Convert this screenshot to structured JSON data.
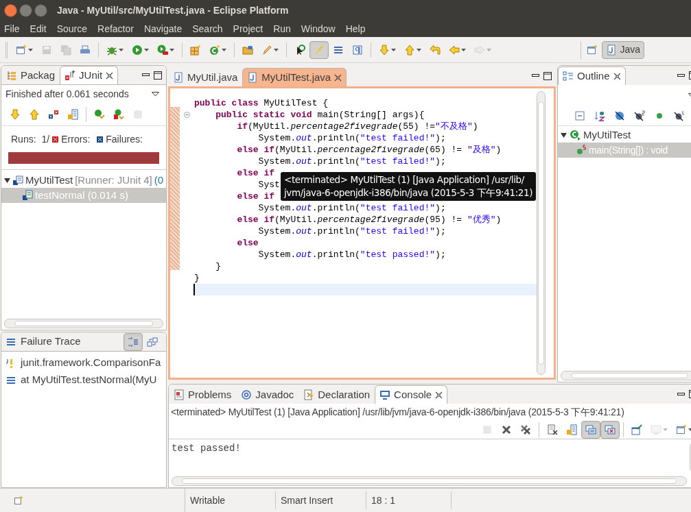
{
  "window": {
    "title": "Java - MyUtil/src/MyUtilTest.java - Eclipse Platform"
  },
  "menu": [
    "File",
    "Edit",
    "Source",
    "Refactor",
    "Navigate",
    "Search",
    "Project",
    "Run",
    "Window",
    "Help"
  ],
  "toolbar": [
    [
      {
        "kind": "new",
        "menu": true,
        "disabled": false,
        "pressed": false
      },
      {
        "kind": "save",
        "menu": false,
        "disabled": true,
        "pressed": false
      },
      {
        "kind": "save-all",
        "menu": false,
        "disabled": true,
        "pressed": false
      },
      {
        "kind": "print",
        "menu": false,
        "disabled": false,
        "pressed": false
      }
    ],
    [
      {
        "kind": "bug",
        "menu": true,
        "disabled": false,
        "pressed": false
      },
      {
        "kind": "run",
        "menu": true,
        "disabled": false,
        "pressed": false
      },
      {
        "kind": "run-tool",
        "menu": true,
        "disabled": false,
        "pressed": false
      }
    ],
    [
      {
        "kind": "package",
        "menu": false,
        "disabled": false,
        "pressed": false
      },
      {
        "kind": "class",
        "menu": true,
        "disabled": false,
        "pressed": false
      }
    ],
    [
      {
        "kind": "folder",
        "menu": false,
        "disabled": false,
        "pressed": false
      },
      {
        "kind": "pen",
        "menu": true,
        "disabled": false,
        "pressed": false
      }
    ],
    [
      {
        "kind": "pointer",
        "menu": false,
        "disabled": false,
        "pressed": false
      },
      {
        "kind": "brush",
        "menu": false,
        "disabled": false,
        "pressed": true
      },
      {
        "kind": "frame",
        "menu": false,
        "disabled": false,
        "pressed": false
      },
      {
        "kind": "pilcrow",
        "menu": false,
        "disabled": false,
        "pressed": false
      }
    ],
    [
      {
        "kind": "down",
        "menu": true,
        "disabled": false,
        "pressed": false
      },
      {
        "kind": "up",
        "menu": true,
        "disabled": false,
        "pressed": false
      },
      {
        "kind": "return",
        "menu": false,
        "disabled": false,
        "pressed": false
      },
      {
        "kind": "left",
        "menu": true,
        "disabled": false,
        "pressed": false
      },
      {
        "kind": "right",
        "menu": true,
        "disabled": true,
        "pressed": false
      }
    ]
  ],
  "perspective": {
    "label": "Java",
    "selected": true
  },
  "junit_view": {
    "tabs": [
      {
        "label": "Packag",
        "kind": "packages",
        "selected": false
      },
      {
        "label": "JUnit",
        "kind": "junit",
        "selected": true
      }
    ],
    "status": "Finished after 0.061 seconds",
    "toolbar": [
      [
        {
          "kind": "down",
          "menu": false,
          "disabled": false,
          "pressed": false
        },
        {
          "kind": "up",
          "menu": false,
          "disabled": false,
          "pressed": false
        },
        {
          "kind": "crosses",
          "menu": false,
          "disabled": false,
          "pressed": false
        },
        {
          "kind": "layout",
          "menu": false,
          "disabled": false,
          "pressed": false
        }
      ],
      [
        {
          "kind": "rerun",
          "menu": false,
          "disabled": false,
          "pressed": false
        },
        {
          "kind": "rerun-failed",
          "menu": false,
          "disabled": false,
          "pressed": false
        },
        {
          "kind": "stop",
          "menu": false,
          "disabled": true,
          "pressed": false
        }
      ]
    ],
    "counters": [
      {
        "kind": "runs",
        "label": "Runs:",
        "value": "1/"
      },
      {
        "kind": "errors",
        "label": "Errors:"
      },
      {
        "kind": "failures",
        "label": "Failures:"
      }
    ],
    "progress": {
      "level": 1
    },
    "tree": [
      {
        "label": "MyUtilTest",
        "detail": "[Runner: JUnit 4]",
        "time": "(0",
        "expanded": true,
        "selected": false,
        "children": [
          {
            "label": "testNormal (0.014 s)",
            "selected": true
          }
        ]
      }
    ]
  },
  "failure_trace": {
    "title": "Failure Trace",
    "toolbar": [
      [
        {
          "kind": "filter-stack",
          "menu": false,
          "disabled": false,
          "pressed": true
        },
        {
          "kind": "compare",
          "menu": false,
          "disabled": false,
          "pressed": false
        }
      ]
    ],
    "lines": [
      {
        "kind": "exception",
        "text": "junit.framework.ComparisonFa"
      },
      {
        "kind": "frame",
        "text": "at MyUtilTest.testNormal(MyU"
      }
    ]
  },
  "editor": {
    "tabs": [
      {
        "label": "MyUtil.java",
        "selected": false
      },
      {
        "label": "MyUtilTest.java",
        "selected": true
      }
    ],
    "lines": [
      {
        "current": false,
        "segments": [
          {
            "kind": "kw",
            "text": "public class "
          },
          {
            "kind": "plain",
            "text": "MyUtilTest {"
          }
        ]
      },
      {
        "current": false,
        "folding": true,
        "segments": [
          {
            "kind": "kw",
            "text": "    public static void "
          },
          {
            "kind": "plain",
            "text": "main(String[] args){"
          }
        ]
      },
      {
        "current": false,
        "segments": [
          {
            "kind": "kw",
            "text": "        if"
          },
          {
            "kind": "plain",
            "text": "(MyUtil."
          },
          {
            "kind": "method",
            "text": "percentage2fivegrade"
          },
          {
            "kind": "plain",
            "text": "(55) !="
          },
          {
            "kind": "str",
            "text": "\"不及格\""
          },
          {
            "kind": "plain",
            "text": ")"
          }
        ]
      },
      {
        "current": false,
        "segments": [
          {
            "kind": "plain",
            "text": "            System."
          },
          {
            "kind": "field",
            "text": "out"
          },
          {
            "kind": "plain",
            "text": ".println("
          },
          {
            "kind": "str",
            "text": "\"test failed!\""
          },
          {
            "kind": "plain",
            "text": ");"
          }
        ]
      },
      {
        "current": false,
        "segments": [
          {
            "kind": "kw",
            "text": "        else if"
          },
          {
            "kind": "plain",
            "text": "(MyUtil."
          },
          {
            "kind": "method",
            "text": "percentage2fivegrade"
          },
          {
            "kind": "plain",
            "text": "(65) != "
          },
          {
            "kind": "str",
            "text": "\"及格\""
          },
          {
            "kind": "plain",
            "text": ")"
          }
        ]
      },
      {
        "current": false,
        "segments": [
          {
            "kind": "plain",
            "text": "            System."
          },
          {
            "kind": "field",
            "text": "out"
          },
          {
            "kind": "plain",
            "text": ".println("
          },
          {
            "kind": "str",
            "text": "\"test failed!\""
          },
          {
            "kind": "plain",
            "text": ");"
          }
        ]
      },
      {
        "current": false,
        "segments": [
          {
            "kind": "kw",
            "text": "        else if"
          }
        ]
      },
      {
        "current": false,
        "segments": [
          {
            "kind": "plain",
            "text": "            Syst"
          }
        ]
      },
      {
        "current": false,
        "segments": [
          {
            "kind": "kw",
            "text": "        else if"
          }
        ]
      },
      {
        "current": false,
        "segments": [
          {
            "kind": "plain",
            "text": "            System."
          },
          {
            "kind": "field",
            "text": "out"
          },
          {
            "kind": "plain",
            "text": ".println("
          },
          {
            "kind": "str",
            "text": "\"test failed!\""
          },
          {
            "kind": "plain",
            "text": ");"
          }
        ]
      },
      {
        "current": false,
        "segments": [
          {
            "kind": "kw",
            "text": "        else if"
          },
          {
            "kind": "plain",
            "text": "(MyUtil."
          },
          {
            "kind": "method",
            "text": "percentage2fivegrade"
          },
          {
            "kind": "plain",
            "text": "(95) != "
          },
          {
            "kind": "str",
            "text": "\"优秀\""
          },
          {
            "kind": "plain",
            "text": ")"
          }
        ]
      },
      {
        "current": false,
        "segments": [
          {
            "kind": "plain",
            "text": "            System."
          },
          {
            "kind": "field",
            "text": "out"
          },
          {
            "kind": "plain",
            "text": ".println("
          },
          {
            "kind": "str",
            "text": "\"test failed!\""
          },
          {
            "kind": "plain",
            "text": ");"
          }
        ]
      },
      {
        "current": false,
        "segments": [
          {
            "kind": "kw",
            "text": "        else"
          }
        ]
      },
      {
        "current": false,
        "segments": [
          {
            "kind": "plain",
            "text": "            System."
          },
          {
            "kind": "field",
            "text": "out"
          },
          {
            "kind": "plain",
            "text": ".println("
          },
          {
            "kind": "str",
            "text": "\"test passed!\""
          },
          {
            "kind": "plain",
            "text": ");"
          }
        ]
      },
      {
        "current": false,
        "segments": [
          {
            "kind": "plain",
            "text": "    }"
          }
        ]
      },
      {
        "current": false,
        "segments": [
          {
            "kind": "plain",
            "text": "}"
          }
        ]
      },
      {
        "current": true
      }
    ],
    "tooltip": [
      "<terminated> MyUtilTest (1) [Java Application] /usr/lib/",
      "jvm/java-6-openjdk-i386/bin/java (2015-5-3 下午9:41:21)"
    ]
  },
  "outline": {
    "title": "Outline",
    "toolbar": [
      [
        {
          "kind": "collapse",
          "menu": false,
          "disabled": false,
          "pressed": false
        },
        {
          "kind": "sort",
          "menu": false,
          "disabled": false,
          "pressed": false
        },
        {
          "kind": "hide-fields",
          "menu": false,
          "disabled": false,
          "pressed": false
        },
        {
          "kind": "hide-static",
          "menu": false,
          "disabled": false,
          "pressed": false
        },
        {
          "kind": "dot",
          "menu": false,
          "disabled": false,
          "pressed": false
        },
        {
          "kind": "hide-local",
          "menu": false,
          "disabled": false,
          "pressed": false
        }
      ]
    ],
    "tree": [
      {
        "label": "MyUtilTest",
        "expanded": true,
        "selected": false,
        "children": [
          {
            "label": "main(String[]) : void",
            "selected": true
          }
        ]
      }
    ]
  },
  "console": {
    "tabs": [
      {
        "label": "Problems",
        "kind": "problems",
        "selected": false
      },
      {
        "label": "Javadoc",
        "kind": "javadoc",
        "selected": false
      },
      {
        "label": "Declaration",
        "kind": "declaration",
        "selected": false
      },
      {
        "label": "Console",
        "kind": "console",
        "selected": true
      }
    ],
    "description": "<terminated> MyUtilTest (1) [Java Application] /usr/lib/jvm/java-6-openjdk-i386/bin/java (2015-5-3 下午9:41:21)",
    "toolbar": [
      [
        {
          "kind": "stop",
          "menu": false,
          "disabled": true,
          "pressed": false
        },
        {
          "kind": "remove",
          "menu": false,
          "disabled": false,
          "pressed": false
        },
        {
          "kind": "remove-all",
          "menu": false,
          "disabled": false,
          "pressed": false
        }
      ],
      [
        {
          "kind": "clear",
          "menu": false,
          "disabled": false,
          "pressed": false
        },
        {
          "kind": "layout",
          "menu": false,
          "disabled": false,
          "pressed": false
        },
        {
          "kind": "stdout",
          "menu": false,
          "disabled": false,
          "pressed": true
        },
        {
          "kind": "stderr",
          "menu": false,
          "disabled": false,
          "pressed": true
        }
      ],
      [
        {
          "kind": "pin",
          "menu": false,
          "disabled": false,
          "pressed": false
        },
        {
          "kind": "display",
          "menu": true,
          "disabled": true,
          "pressed": false
        },
        {
          "kind": "new",
          "menu": true,
          "disabled": false,
          "pressed": false
        }
      ]
    ],
    "output": "test passed!"
  },
  "status_bar": [
    "Writable",
    "Smart Insert",
    "18 : 1"
  ]
}
